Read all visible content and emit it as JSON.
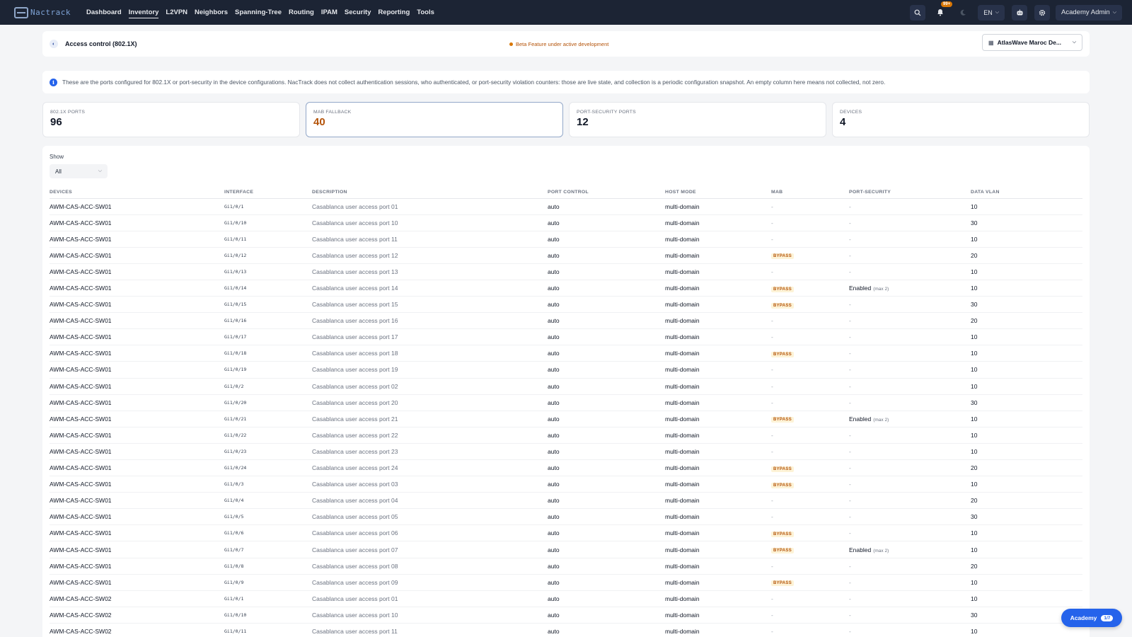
{
  "nav": {
    "logo_text": "Nactrack",
    "items": [
      {
        "label": "Dashboard"
      },
      {
        "label": "Inventory"
      },
      {
        "label": "L2VPN"
      },
      {
        "label": "Neighbors"
      },
      {
        "label": "Spanning-Tree"
      },
      {
        "label": "Routing"
      },
      {
        "label": "IPAM"
      },
      {
        "label": "Security"
      },
      {
        "label": "Reporting"
      },
      {
        "label": "Tools"
      }
    ],
    "active_item": "Inventory",
    "notification_badge": "99+",
    "language": "EN",
    "user": "Academy Admin",
    "icons": [
      "search-icon",
      "bell-icon",
      "moon-icon",
      "robot-icon",
      "gear-icon"
    ]
  },
  "header": {
    "title": "Access control (802.1X)",
    "beta_text": "Beta Feature under active development",
    "site_selector": "AtlasWave Maroc De..."
  },
  "info": {
    "text": "These are the ports configured for 802.1X or port-security in the device configurations. NacTrack does not collect authentication sessions, who authenticated, or port-security violation counters: those are live state, and collection is a periodic configuration snapshot. An empty column here means not collected, not zero."
  },
  "stats": [
    {
      "label": "802.1X PORTS",
      "value": "96"
    },
    {
      "label": "MAB FALLBACK",
      "value": "40"
    },
    {
      "label": "PORT-SECURITY PORTS",
      "value": "12"
    },
    {
      "label": "DEVICES",
      "value": "4"
    }
  ],
  "filter": {
    "label": "Show",
    "value": "All"
  },
  "table": {
    "columns": [
      "DEVICES",
      "INTERFACE",
      "DESCRIPTION",
      "PORT CONTROL",
      "HOST MODE",
      "MAB",
      "PORT-SECURITY",
      "DATA VLAN"
    ],
    "rows": [
      {
        "device": "AWM-CAS-ACC-SW01",
        "iface": "Gi1/0/1",
        "desc": "Casablanca user access port 01",
        "control": "auto",
        "mode": "multi-domain",
        "mab": "-",
        "ps": "-",
        "ps_max": "",
        "vlan": "10"
      },
      {
        "device": "AWM-CAS-ACC-SW01",
        "iface": "Gi1/0/10",
        "desc": "Casablanca user access port 10",
        "control": "auto",
        "mode": "multi-domain",
        "mab": "-",
        "ps": "-",
        "ps_max": "",
        "vlan": "30"
      },
      {
        "device": "AWM-CAS-ACC-SW01",
        "iface": "Gi1/0/11",
        "desc": "Casablanca user access port 11",
        "control": "auto",
        "mode": "multi-domain",
        "mab": "-",
        "ps": "-",
        "ps_max": "",
        "vlan": "10"
      },
      {
        "device": "AWM-CAS-ACC-SW01",
        "iface": "Gi1/0/12",
        "desc": "Casablanca user access port 12",
        "control": "auto",
        "mode": "multi-domain",
        "mab": "BYPASS",
        "ps": "-",
        "ps_max": "",
        "vlan": "20"
      },
      {
        "device": "AWM-CAS-ACC-SW01",
        "iface": "Gi1/0/13",
        "desc": "Casablanca user access port 13",
        "control": "auto",
        "mode": "multi-domain",
        "mab": "-",
        "ps": "-",
        "ps_max": "",
        "vlan": "10"
      },
      {
        "device": "AWM-CAS-ACC-SW01",
        "iface": "Gi1/0/14",
        "desc": "Casablanca user access port 14",
        "control": "auto",
        "mode": "multi-domain",
        "mab": "BYPASS",
        "ps": "Enabled",
        "ps_max": "(max 2)",
        "vlan": "10"
      },
      {
        "device": "AWM-CAS-ACC-SW01",
        "iface": "Gi1/0/15",
        "desc": "Casablanca user access port 15",
        "control": "auto",
        "mode": "multi-domain",
        "mab": "BYPASS",
        "ps": "-",
        "ps_max": "",
        "vlan": "30"
      },
      {
        "device": "AWM-CAS-ACC-SW01",
        "iface": "Gi1/0/16",
        "desc": "Casablanca user access port 16",
        "control": "auto",
        "mode": "multi-domain",
        "mab": "-",
        "ps": "-",
        "ps_max": "",
        "vlan": "20"
      },
      {
        "device": "AWM-CAS-ACC-SW01",
        "iface": "Gi1/0/17",
        "desc": "Casablanca user access port 17",
        "control": "auto",
        "mode": "multi-domain",
        "mab": "-",
        "ps": "-",
        "ps_max": "",
        "vlan": "10"
      },
      {
        "device": "AWM-CAS-ACC-SW01",
        "iface": "Gi1/0/18",
        "desc": "Casablanca user access port 18",
        "control": "auto",
        "mode": "multi-domain",
        "mab": "BYPASS",
        "ps": "-",
        "ps_max": "",
        "vlan": "10"
      },
      {
        "device": "AWM-CAS-ACC-SW01",
        "iface": "Gi1/0/19",
        "desc": "Casablanca user access port 19",
        "control": "auto",
        "mode": "multi-domain",
        "mab": "-",
        "ps": "-",
        "ps_max": "",
        "vlan": "10"
      },
      {
        "device": "AWM-CAS-ACC-SW01",
        "iface": "Gi1/0/2",
        "desc": "Casablanca user access port 02",
        "control": "auto",
        "mode": "multi-domain",
        "mab": "-",
        "ps": "-",
        "ps_max": "",
        "vlan": "10"
      },
      {
        "device": "AWM-CAS-ACC-SW01",
        "iface": "Gi1/0/20",
        "desc": "Casablanca user access port 20",
        "control": "auto",
        "mode": "multi-domain",
        "mab": "-",
        "ps": "-",
        "ps_max": "",
        "vlan": "30"
      },
      {
        "device": "AWM-CAS-ACC-SW01",
        "iface": "Gi1/0/21",
        "desc": "Casablanca user access port 21",
        "control": "auto",
        "mode": "multi-domain",
        "mab": "BYPASS",
        "ps": "Enabled",
        "ps_max": "(max 2)",
        "vlan": "10"
      },
      {
        "device": "AWM-CAS-ACC-SW01",
        "iface": "Gi1/0/22",
        "desc": "Casablanca user access port 22",
        "control": "auto",
        "mode": "multi-domain",
        "mab": "-",
        "ps": "-",
        "ps_max": "",
        "vlan": "10"
      },
      {
        "device": "AWM-CAS-ACC-SW01",
        "iface": "Gi1/0/23",
        "desc": "Casablanca user access port 23",
        "control": "auto",
        "mode": "multi-domain",
        "mab": "-",
        "ps": "-",
        "ps_max": "",
        "vlan": "10"
      },
      {
        "device": "AWM-CAS-ACC-SW01",
        "iface": "Gi1/0/24",
        "desc": "Casablanca user access port 24",
        "control": "auto",
        "mode": "multi-domain",
        "mab": "BYPASS",
        "ps": "-",
        "ps_max": "",
        "vlan": "20"
      },
      {
        "device": "AWM-CAS-ACC-SW01",
        "iface": "Gi1/0/3",
        "desc": "Casablanca user access port 03",
        "control": "auto",
        "mode": "multi-domain",
        "mab": "BYPASS",
        "ps": "-",
        "ps_max": "",
        "vlan": "10"
      },
      {
        "device": "AWM-CAS-ACC-SW01",
        "iface": "Gi1/0/4",
        "desc": "Casablanca user access port 04",
        "control": "auto",
        "mode": "multi-domain",
        "mab": "-",
        "ps": "-",
        "ps_max": "",
        "vlan": "20"
      },
      {
        "device": "AWM-CAS-ACC-SW01",
        "iface": "Gi1/0/5",
        "desc": "Casablanca user access port 05",
        "control": "auto",
        "mode": "multi-domain",
        "mab": "-",
        "ps": "-",
        "ps_max": "",
        "vlan": "30"
      },
      {
        "device": "AWM-CAS-ACC-SW01",
        "iface": "Gi1/0/6",
        "desc": "Casablanca user access port 06",
        "control": "auto",
        "mode": "multi-domain",
        "mab": "BYPASS",
        "ps": "-",
        "ps_max": "",
        "vlan": "10"
      },
      {
        "device": "AWM-CAS-ACC-SW01",
        "iface": "Gi1/0/7",
        "desc": "Casablanca user access port 07",
        "control": "auto",
        "mode": "multi-domain",
        "mab": "BYPASS",
        "ps": "Enabled",
        "ps_max": "(max 2)",
        "vlan": "10"
      },
      {
        "device": "AWM-CAS-ACC-SW01",
        "iface": "Gi1/0/8",
        "desc": "Casablanca user access port 08",
        "control": "auto",
        "mode": "multi-domain",
        "mab": "-",
        "ps": "-",
        "ps_max": "",
        "vlan": "20"
      },
      {
        "device": "AWM-CAS-ACC-SW01",
        "iface": "Gi1/0/9",
        "desc": "Casablanca user access port 09",
        "control": "auto",
        "mode": "multi-domain",
        "mab": "BYPASS",
        "ps": "-",
        "ps_max": "",
        "vlan": "10"
      },
      {
        "device": "AWM-CAS-ACC-SW02",
        "iface": "Gi1/0/1",
        "desc": "Casablanca user access port 01",
        "control": "auto",
        "mode": "multi-domain",
        "mab": "-",
        "ps": "-",
        "ps_max": "",
        "vlan": "10"
      },
      {
        "device": "AWM-CAS-ACC-SW02",
        "iface": "Gi1/0/10",
        "desc": "Casablanca user access port 10",
        "control": "auto",
        "mode": "multi-domain",
        "mab": "-",
        "ps": "-",
        "ps_max": "",
        "vlan": "30"
      },
      {
        "device": "AWM-CAS-ACC-SW02",
        "iface": "Gi1/0/11",
        "desc": "Casablanca user access port 11",
        "control": "auto",
        "mode": "multi-domain",
        "mab": "-",
        "ps": "-",
        "ps_max": "",
        "vlan": "10"
      }
    ]
  },
  "academy": {
    "label": "Academy",
    "count": "1/7"
  },
  "colors": {
    "nav_bg": "#1c2434",
    "accent": "#2563eb",
    "beta": "#d97706",
    "bypass_bg": "#fdf3d7",
    "bypass_fg": "#b45309"
  }
}
